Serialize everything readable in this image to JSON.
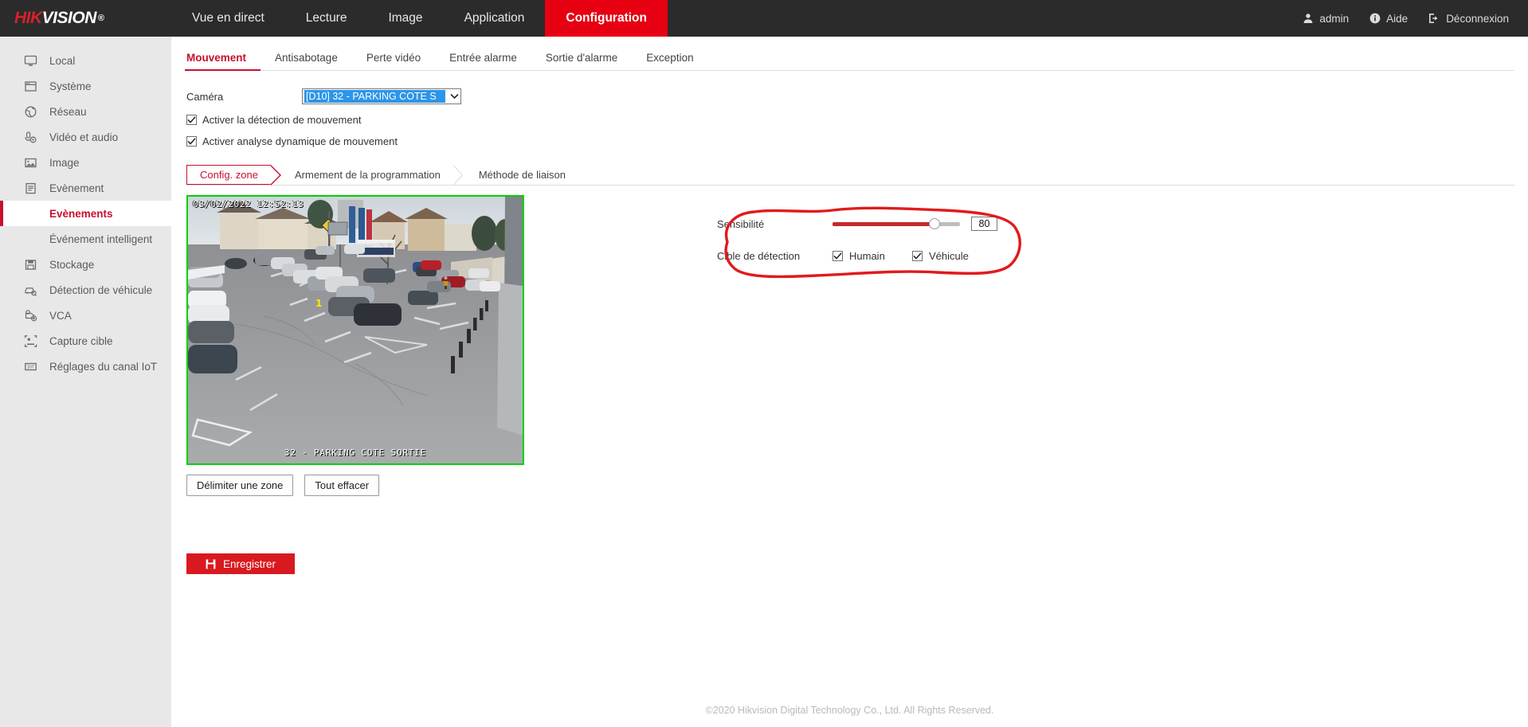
{
  "brand": {
    "name_part1": "HIK",
    "name_part2": "VISION",
    "registered": "®"
  },
  "topnav": {
    "items": [
      {
        "label": "Vue en direct",
        "active": false
      },
      {
        "label": "Lecture",
        "active": false
      },
      {
        "label": "Image",
        "active": false
      },
      {
        "label": "Application",
        "active": false
      },
      {
        "label": "Configuration",
        "active": true
      }
    ],
    "user": "admin",
    "help": "Aide",
    "logout": "Déconnexion"
  },
  "sidebar": {
    "items": [
      {
        "label": "Local",
        "icon": "monitor-icon"
      },
      {
        "label": "Système",
        "icon": "window-icon"
      },
      {
        "label": "Réseau",
        "icon": "globe-icon"
      },
      {
        "label": "Vidéo et audio",
        "icon": "mic-icon"
      },
      {
        "label": "Image",
        "icon": "picture-icon"
      },
      {
        "label": "Evènement",
        "icon": "clipboard-icon"
      }
    ],
    "sub_items": [
      {
        "label": "Evènements",
        "active": true
      },
      {
        "label": "Événement intelligent",
        "active": false
      }
    ],
    "items_after": [
      {
        "label": "Stockage",
        "icon": "save-disk-icon"
      },
      {
        "label": "Détection de véhicule",
        "icon": "vehicle-search-icon"
      },
      {
        "label": "VCA",
        "icon": "vca-icon"
      },
      {
        "label": "Capture cible",
        "icon": "target-capture-icon"
      },
      {
        "label": "Réglages du canal IoT",
        "icon": "iot-icon"
      }
    ]
  },
  "tabs": [
    {
      "label": "Mouvement",
      "active": true
    },
    {
      "label": "Antisabotage",
      "active": false
    },
    {
      "label": "Perte vidéo",
      "active": false
    },
    {
      "label": "Entrée alarme",
      "active": false
    },
    {
      "label": "Sortie d'alarme",
      "active": false
    },
    {
      "label": "Exception",
      "active": false
    }
  ],
  "form": {
    "camera_label": "Caméra",
    "camera_value": "[D10] 32 - PARKING COTE S",
    "enable_motion_detection": "Activer la détection de mouvement",
    "enable_motion_detection_checked": true,
    "enable_dynamic_analysis": "Activer analyse dynamique de mouvement",
    "enable_dynamic_analysis_checked": true
  },
  "subtabs": [
    {
      "label": "Config. zone",
      "active": true
    },
    {
      "label": "Armement de la programmation",
      "active": false
    },
    {
      "label": "Méthode de liaison",
      "active": false
    }
  ],
  "video": {
    "timestamp": "03/02/2022 12:52:13",
    "camera_overlay": "32 - PARKING COTE SORTIE",
    "border_color": "#00d000"
  },
  "buttons": {
    "draw_area": "Délimiter une zone",
    "clear_all": "Tout effacer",
    "save": "Enregistrer"
  },
  "settings": {
    "sensitivity_label": "Sensibilité",
    "sensitivity_value": "80",
    "sensitivity_percent": 80,
    "detection_target_label": "Cible de détection",
    "targets": [
      {
        "label": "Humain",
        "checked": true
      },
      {
        "label": "Véhicule",
        "checked": true
      }
    ]
  },
  "annotation": {
    "color": "#e01b1b",
    "shape": "hand-drawn-ellipse"
  },
  "footer": "©2020 Hikvision Digital Technology Co., Ltd. All Rights Reserved."
}
